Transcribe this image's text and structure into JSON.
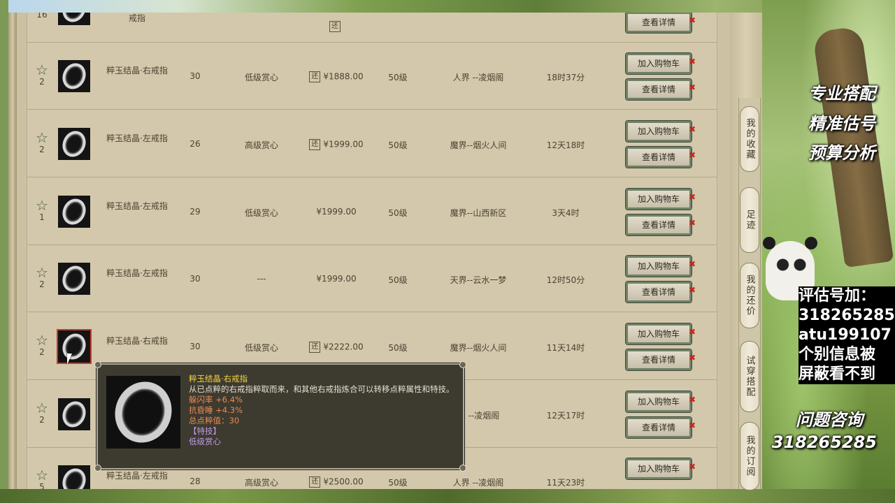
{
  "rows": [
    {
      "fav": "16",
      "name": "戒指",
      "level": "",
      "grade": "",
      "price": "",
      "has_return": true,
      "lvl": "",
      "server": "",
      "time": "",
      "btn_add": "",
      "btn_detail": "查看详情"
    },
    {
      "fav": "2",
      "name": "粹玉结晶·右戒指",
      "level": "30",
      "grade": "低级赏心",
      "price": "¥1888.00",
      "has_return": true,
      "lvl": "50级",
      "server": "人界 --凌烟阁",
      "time": "18时37分",
      "btn_add": "加入购物车",
      "btn_detail": "查看详情"
    },
    {
      "fav": "2",
      "name": "粹玉结晶·左戒指",
      "level": "26",
      "grade": "高级赏心",
      "price": "¥1999.00",
      "has_return": true,
      "lvl": "50级",
      "server": "魔界--烟火人间",
      "time": "12天18时",
      "btn_add": "加入购物车",
      "btn_detail": "查看详情"
    },
    {
      "fav": "1",
      "name": "粹玉结晶·左戒指",
      "level": "29",
      "grade": "低级赏心",
      "price": "¥1999.00",
      "has_return": false,
      "lvl": "50级",
      "server": "魔界--山西新区",
      "time": "3天4时",
      "btn_add": "加入购物车",
      "btn_detail": "查看详情"
    },
    {
      "fav": "2",
      "name": "粹玉结晶·左戒指",
      "level": "30",
      "grade": "---",
      "price": "¥1999.00",
      "has_return": false,
      "lvl": "50级",
      "server": "天界--云水一梦",
      "time": "12时50分",
      "btn_add": "加入购物车",
      "btn_detail": "查看详情"
    },
    {
      "fav": "2",
      "name": "粹玉结晶·右戒指",
      "level": "30",
      "grade": "低级赏心",
      "price": "¥2222.00",
      "has_return": true,
      "lvl": "50级",
      "server": "魔界--烟火人间",
      "time": "11天14时",
      "btn_add": "加入购物车",
      "btn_detail": "查看详情"
    },
    {
      "fav": "2",
      "name": "",
      "level": "",
      "grade": "",
      "price": "",
      "has_return": false,
      "lvl": "",
      "server": "界 --凌烟阁",
      "time": "12天17时",
      "btn_add": "加入购物车",
      "btn_detail": "查看详情"
    },
    {
      "fav": "5",
      "name": "粹玉结晶·左戒指",
      "level": "28",
      "grade": "高级赏心",
      "price": "¥2500.00",
      "has_return": true,
      "lvl": "50级",
      "server": "人界 --凌烟阁",
      "time": "11天23时",
      "btn_add": "加入购物车",
      "btn_detail": ""
    }
  ],
  "return_icon": "还",
  "sidenav": [
    "我的收藏",
    "足迹",
    "我的还价",
    "试穿搭配",
    "我的订阅"
  ],
  "promo": {
    "line1": "专业搭配",
    "line2": "精准估号",
    "line3": "预算分析",
    "eval_lines": [
      "评估号加：",
      "318265285",
      "atu199107",
      "个别信息被",
      "屏蔽看不到"
    ],
    "consult": "问题咨询",
    "consult_num": "318265285"
  },
  "tooltip": {
    "title": "粹玉结晶·右戒指",
    "desc": "从已点粹的右戒指粹取而来，和其他右戒指炼合可以转移点粹属性和特技。",
    "stat1": "躲闪率 +6.4%",
    "stat2": "抗昏睡 +4.3%",
    "total": "总点粹值：30",
    "skill_label": "【特技】",
    "skill": "低级赏心"
  },
  "colors": {
    "accent_red": "#c4271d",
    "title_yellow": "#f2d441",
    "stat_orange": "#e88a52",
    "skill_purple": "#c29ae6"
  }
}
